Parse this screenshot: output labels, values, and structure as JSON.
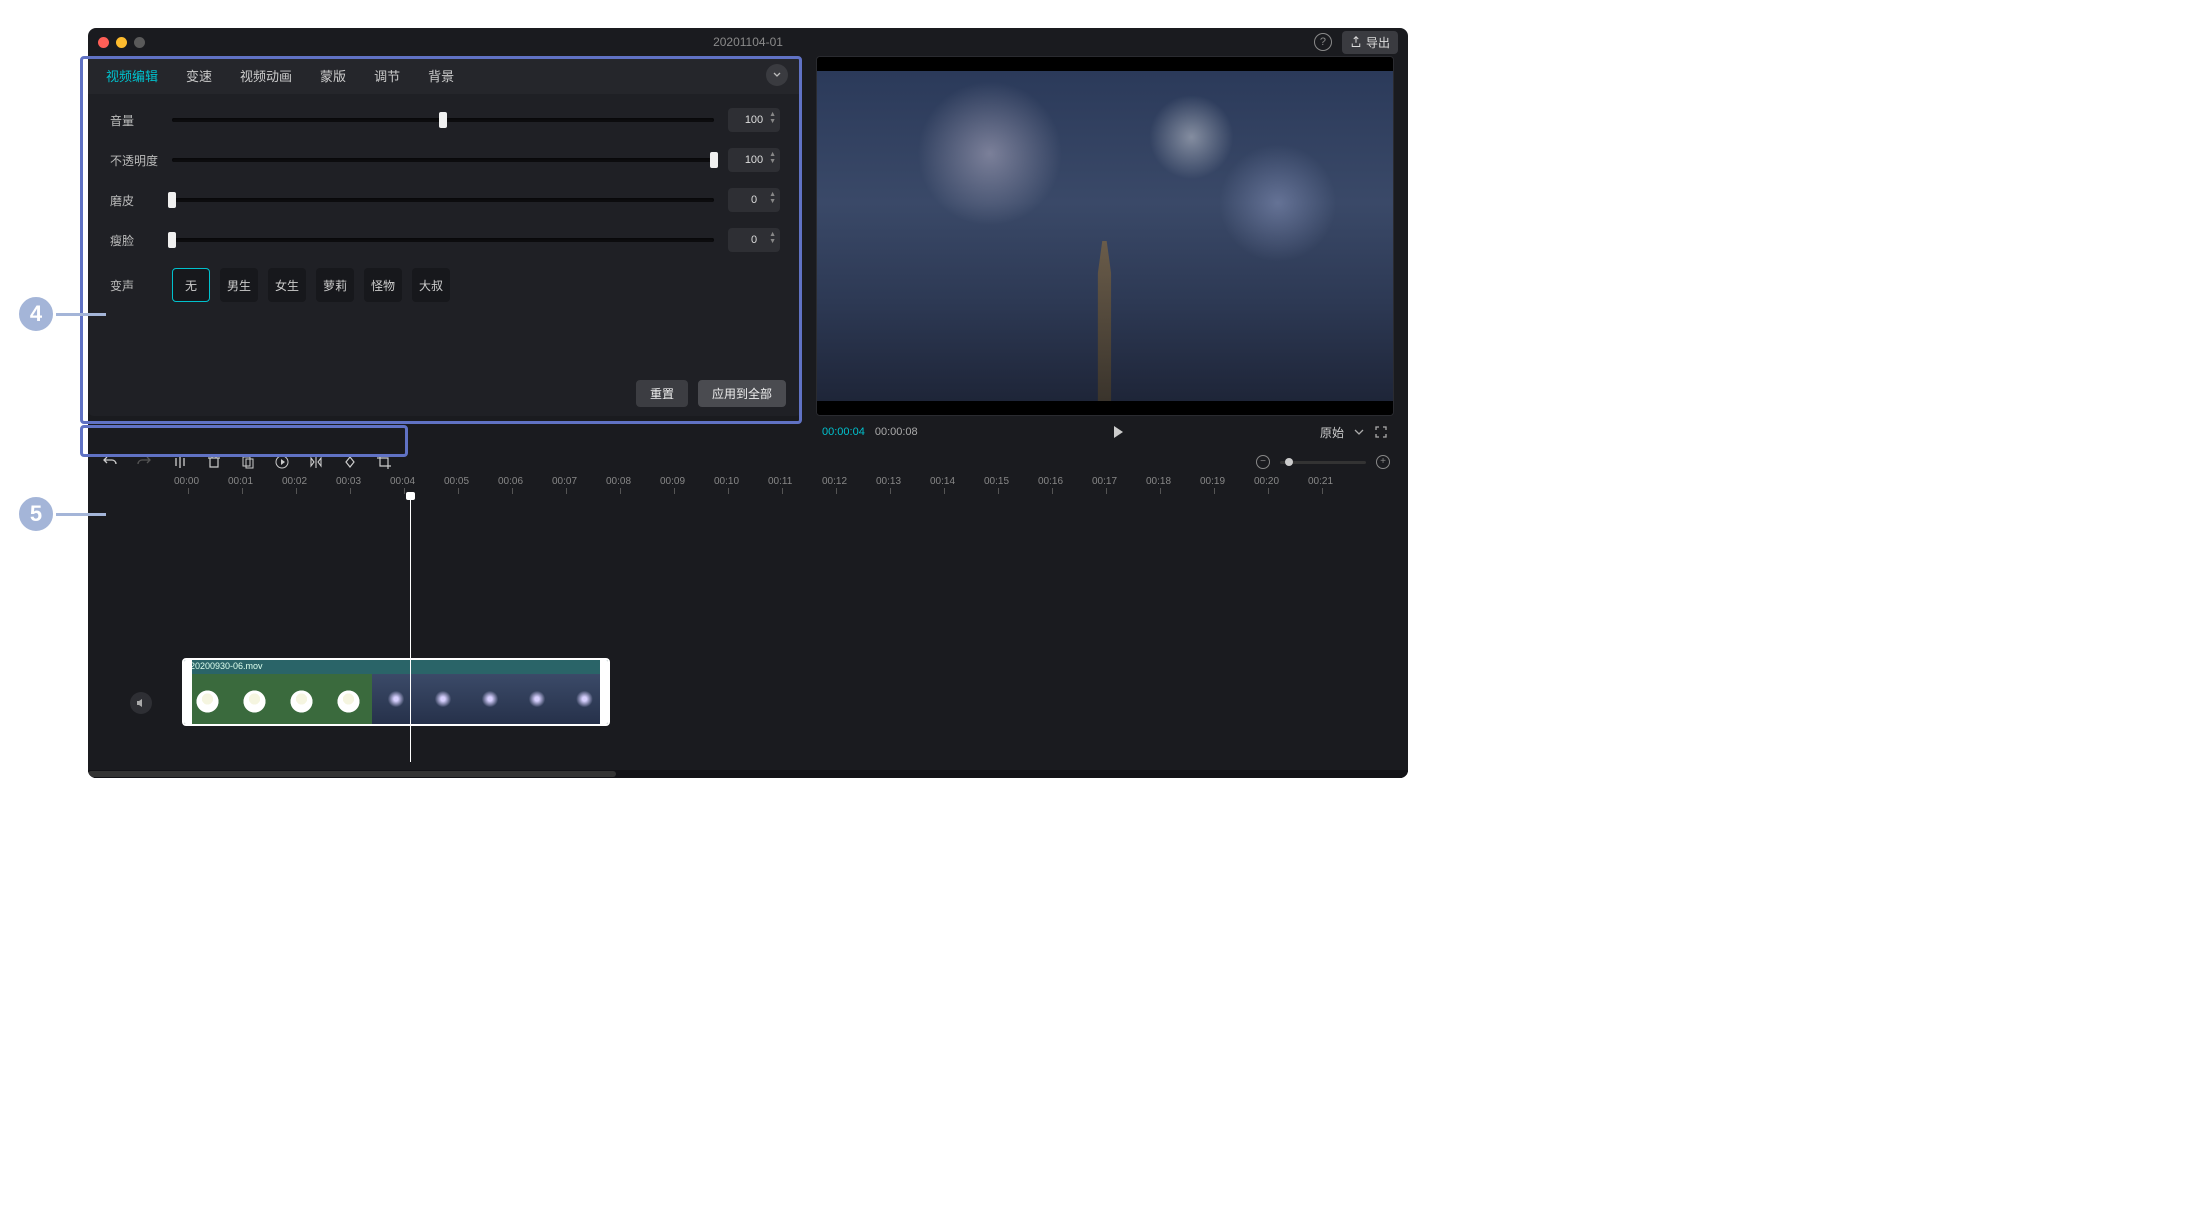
{
  "callouts": {
    "a": "4",
    "b": "5"
  },
  "titlebar": {
    "project_name": "20201104-01",
    "export_label": "导出"
  },
  "panel": {
    "tabs": {
      "video_edit": "视频编辑",
      "speed": "变速",
      "animation": "视频动画",
      "mask": "蒙版",
      "adjust": "调节",
      "background": "背景"
    },
    "volume": {
      "label": "音量",
      "value": "100",
      "percent": 50
    },
    "opacity": {
      "label": "不透明度",
      "value": "100",
      "percent": 100
    },
    "smooth": {
      "label": "磨皮",
      "value": "0",
      "percent": 0
    },
    "slim": {
      "label": "瘦脸",
      "value": "0",
      "percent": 0
    },
    "voice": {
      "label": "变声",
      "options": {
        "none": "无",
        "male": "男生",
        "female": "女生",
        "loli": "萝莉",
        "monster": "怪物",
        "uncle": "大叔"
      }
    },
    "footer": {
      "reset": "重置",
      "apply_all": "应用到全部"
    }
  },
  "preview": {
    "current_time": "00:00:04",
    "total_time": "00:00:08",
    "scale_label": "原始"
  },
  "ruler": {
    "ticks": [
      "00:00",
      "00:01",
      "00:02",
      "00:03",
      "00:04",
      "00:05",
      "00:06",
      "00:07",
      "00:08",
      "00:09",
      "00:10",
      "00:11",
      "00:12",
      "00:13",
      "00:14",
      "00:15",
      "00:16",
      "00:17",
      "00:18",
      "00:19",
      "00:20",
      "00:21"
    ]
  },
  "clip": {
    "filename": "20200930-06.mov",
    "duration": "7.3s"
  }
}
